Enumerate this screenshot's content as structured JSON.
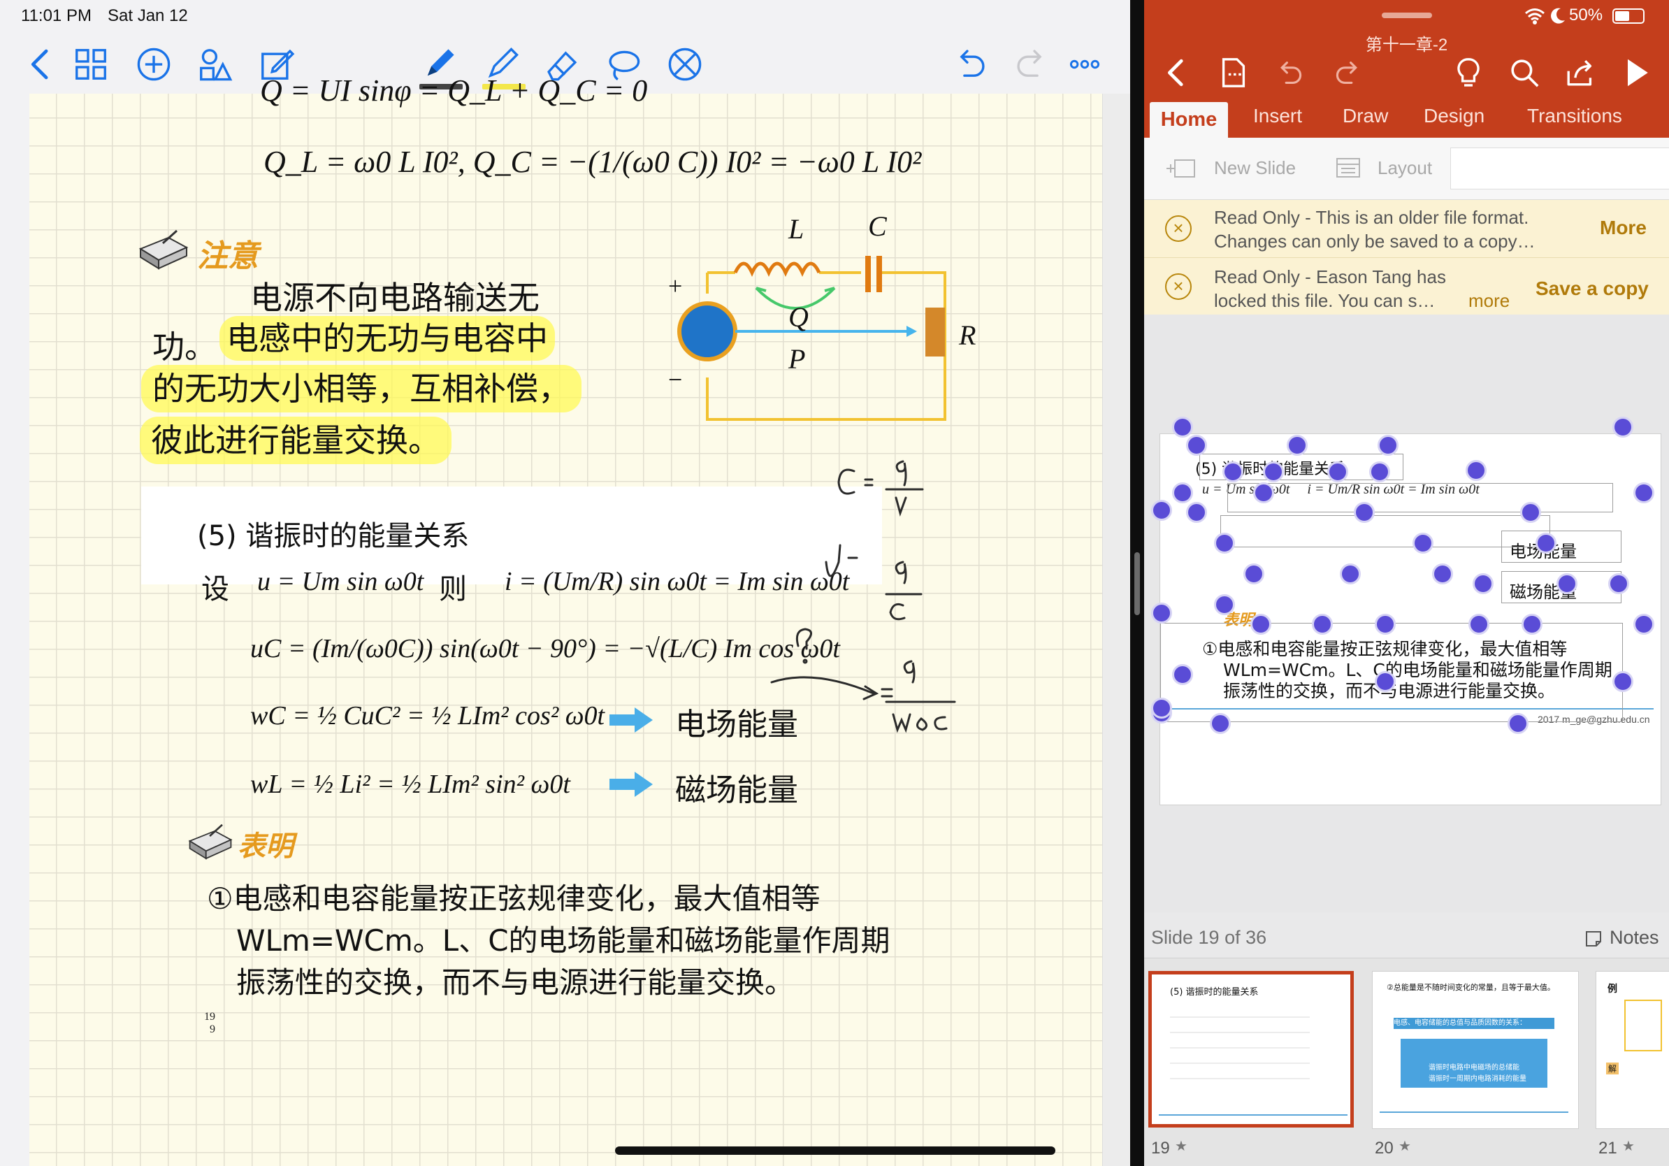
{
  "status_left": {
    "time": "11:01 PM",
    "date": "Sat Jan 12"
  },
  "status_right": {
    "battery": "50%"
  },
  "note": {
    "eq_top_partial": "Q = UI sinφ = Q_L + Q_C = 0",
    "eq_ql": "Q_L = ω0 L I0²,  Q_C = −(1/(ω0 C)) I0² = −ω0 L I0²",
    "note_title": "注意",
    "note_line1": "电源不向电路输送无",
    "note_line2a": "功。",
    "note_line2b": "电感中的无功与电容中",
    "note_line3": "的无功大小相等，互相补偿，",
    "note_line4": "彼此进行能量交换。",
    "circuit": {
      "L": "L",
      "C": "C",
      "Q": "Q",
      "P": "P",
      "R": "R",
      "plus": "+",
      "minus": "−"
    },
    "section_title": "(5) 谐振时的能量关系",
    "she": "设",
    "ze": "则",
    "eq_u": "u = Um sin ω0t",
    "eq_i": "i = (Um/R) sin ω0t = Im sin ω0t",
    "eq_uc": "uC = (Im/(ω0C)) sin(ω0t − 90°) = −√(L/C) Im cos ω0t",
    "eq_wc": "wC = ½ CuC² = ½ LIm² cos² ω0t",
    "eq_wl": "wL = ½ Li² = ½ LIm² sin² ω0t",
    "electric_energy": "电场能量",
    "magnetic_energy": "磁场能量",
    "biaoming_title": "表明",
    "conclusion_line1": "①电感和电容能量按正弦规律变化，最大值相等",
    "conclusion_line2": "WLm=WCm。L、C的电场能量和磁场能量作周期",
    "conclusion_line3": "振荡性的交换，而不与电源进行能量交换。",
    "page_num": "19",
    "page_sub": "9",
    "handwriting": {
      "c_eq": "C = q/U",
      "u_eq": "U = q/C",
      "q_mark": "?",
      "arrow_eq": "= q/(ω0C)"
    }
  },
  "ppt": {
    "file_title": "第十一章-2",
    "tabs": [
      "Home",
      "Insert",
      "Draw",
      "Design",
      "Transitions"
    ],
    "ribbon": {
      "new_slide": "New Slide",
      "layout": "Layout"
    },
    "readonly_bar1": {
      "line1": "Read Only - This is an older file format.",
      "line2": "Changes can only be saved to a copy…",
      "action": "More"
    },
    "readonly_bar2": {
      "line1": "Read Only - Eason Tang has",
      "line2": "locked this file. You can s…",
      "more": "more",
      "action": "Save a copy"
    },
    "slide": {
      "title": "(5) 谐振时的能量关系",
      "electric": "电场能量",
      "magnetic": "磁场能量",
      "biaoming": "表明",
      "line1": "①电感和电容能量按正弦规律变化，最大值相等",
      "line2": "WLm=WCm。L、C的电场能量和磁场能量作周期",
      "line3": "振荡性的交换，而不与电源进行能量交换。",
      "footer": "2017 m_ge@gzhu.edu.cn"
    },
    "slide_counter": "Slide 19 of 36",
    "notes_label": "Notes",
    "thumbs": [
      {
        "num": "19",
        "title": "(5) 谐振时的能量关系"
      },
      {
        "num": "20",
        "title": "②总能量是不随时间变化的常量，且等于最大值。",
        "box1": "电感、电容储能的总值与品质因数的关系：",
        "box2": "谐振时电路中电磁场的总储能",
        "box3": "谐振时一周期内电路消耗的能量"
      },
      {
        "num": "21",
        "title": "例",
        "label": "解"
      }
    ]
  },
  "colors": {
    "ppt_red": "#c43e1c",
    "accent_blue": "#1a73e8",
    "highlight": "#fff950",
    "handle": "#5a4cd6"
  }
}
